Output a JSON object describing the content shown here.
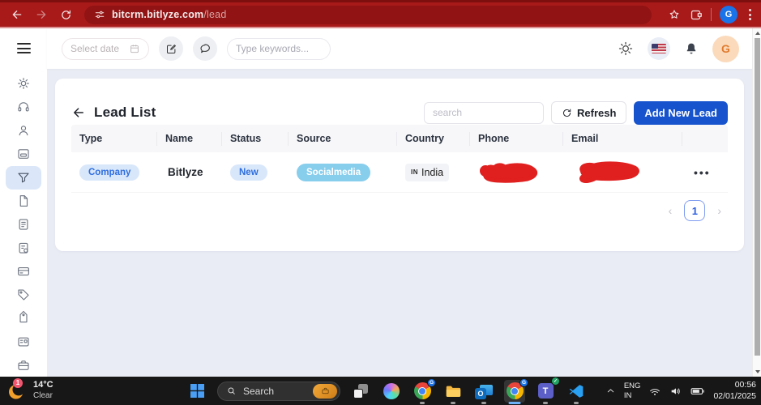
{
  "browser": {
    "url_host": "bitcrm.bitlyze.com",
    "url_path": "/lead",
    "profile_initial": "G"
  },
  "app_header": {
    "select_date_placeholder": "Select date",
    "keywords_placeholder": "Type keywords...",
    "avatar_initial": "G"
  },
  "sidebar": {
    "items": [
      "settings",
      "support",
      "contacts",
      "board",
      "leads",
      "files",
      "reports",
      "tasks",
      "payments",
      "tags",
      "labels",
      "accounts",
      "organization"
    ],
    "active_item": "leads"
  },
  "lead_list": {
    "title": "Lead List",
    "search_placeholder": "search",
    "refresh_label": "Refresh",
    "add_new_label": "Add New Lead",
    "columns": [
      "Type",
      "Name",
      "Status",
      "Source",
      "Country",
      "Phone",
      "Email"
    ],
    "row": {
      "type_badge": "Company",
      "name": "Bitlyze",
      "status_badge": "New",
      "source_badge": "Socialmedia",
      "country_code": "IN",
      "country_name": "India",
      "phone_redacted": true,
      "email_redacted": true,
      "actions": "•••"
    },
    "pagination": {
      "prev": "‹",
      "current_page": "1",
      "next": "›"
    }
  },
  "taskbar": {
    "weather_temp": "14°C",
    "weather_condition": "Clear",
    "weather_badge": "1",
    "search_placeholder": "Search",
    "app_icon_letters": {
      "outlook": "O",
      "teams": "T",
      "teams_check": "✓",
      "chrome_profile": "G"
    },
    "tray": {
      "language_line1": "ENG",
      "language_line2": "IN",
      "time": "00:56",
      "date": "02/01/2025"
    }
  },
  "colors": {
    "browser_chrome": "#a81a1a",
    "accent_blue": "#1653cd",
    "badge_light_blue_bg": "#d9e7fb",
    "badge_blue_text": "#2e6edd",
    "source_badge_bg": "#87cdec",
    "sidebar_active_bg": "#dbe7f8",
    "redaction_red": "#e01f1f"
  }
}
